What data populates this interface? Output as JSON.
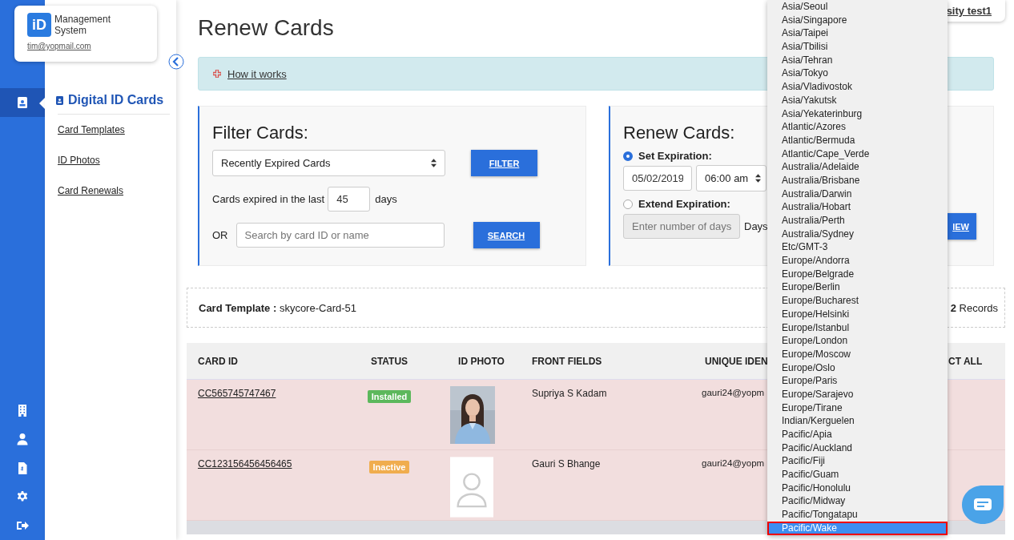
{
  "brand": {
    "logo": "iD",
    "name": "Management System",
    "email": "tim@yopmail.com"
  },
  "rail": [
    {
      "kind": "badge",
      "selected": true
    },
    {
      "kind": "building",
      "selected": false
    },
    {
      "kind": "user",
      "selected": false
    },
    {
      "kind": "invoice",
      "selected": false
    },
    {
      "kind": "settings",
      "selected": false
    },
    {
      "kind": "logout",
      "selected": false
    }
  ],
  "submenu": {
    "title": "Digital ID Cards",
    "links": [
      "Card Templates",
      "ID Photos",
      "Card Renewals"
    ]
  },
  "account": {
    "name": "sity test1"
  },
  "page_title": "Renew Cards",
  "info": {
    "link": "How it works"
  },
  "filter": {
    "title": "Filter Cards:",
    "select": "Recently Expired Cards",
    "filter_button": "FILTER",
    "days_before": "Cards expired in the last",
    "days_value": "45",
    "days_after": "days",
    "or": "OR",
    "search_placeholder": "Search by card ID or name",
    "search_button": "SEARCH"
  },
  "renew": {
    "title": "Renew Cards:",
    "options": [
      {
        "label": "Set Expiration:",
        "selected": true
      },
      {
        "label": "Extend Expiration:",
        "selected": false
      }
    ],
    "date": "05/02/2019",
    "time": "06:00 am",
    "days_placeholder": "Enter number of days",
    "days_unit": "Days",
    "button": "IEW"
  },
  "template": {
    "label": "Card Template :",
    "name": "skycore-Card-51",
    "count": "2",
    "count_label": "Records"
  },
  "table": {
    "columns": [
      "CARD ID",
      "STATUS",
      "ID PHOTO",
      "FRONT FIELDS",
      "UNIQUE IDEN",
      "CT ALL"
    ],
    "rows": [
      {
        "card_id": "CC565745747467",
        "status": {
          "label": "Installed",
          "kind": "installed"
        },
        "front": "Supriya S Kadam",
        "unique": "gauri24@yopm"
      },
      {
        "card_id": "CC123156456456465",
        "status": {
          "label": "Inactive",
          "kind": "inactive"
        },
        "photo": {
          "kind": "empty"
        },
        "front": "Gauri S Bhange",
        "unique": "gauri24@yopm"
      }
    ]
  },
  "timezones": [
    {
      "label": "Asia/Seoul",
      "selected": false
    },
    {
      "label": "Asia/Singapore",
      "selected": false
    },
    {
      "label": "Asia/Taipei",
      "selected": false
    },
    {
      "label": "Asia/Tbilisi",
      "selected": false
    },
    {
      "label": "Asia/Tehran",
      "selected": false
    },
    {
      "label": "Asia/Tokyo",
      "selected": false
    },
    {
      "label": "Asia/Vladivostok",
      "selected": false
    },
    {
      "label": "Asia/Yakutsk",
      "selected": false
    },
    {
      "label": "Asia/Yekaterinburg",
      "selected": false
    },
    {
      "label": "Atlantic/Azores",
      "selected": false
    },
    {
      "label": "Atlantic/Bermuda",
      "selected": false
    },
    {
      "label": "Atlantic/Cape_Verde",
      "selected": false
    },
    {
      "label": "Australia/Adelaide",
      "selected": false
    },
    {
      "label": "Australia/Brisbane",
      "selected": false
    },
    {
      "label": "Australia/Darwin",
      "selected": false
    },
    {
      "label": "Australia/Hobart",
      "selected": false
    },
    {
      "label": "Australia/Perth",
      "selected": false
    },
    {
      "label": "Australia/Sydney",
      "selected": false
    },
    {
      "label": "Etc/GMT-3",
      "selected": false
    },
    {
      "label": "Europe/Andorra",
      "selected": false
    },
    {
      "label": "Europe/Belgrade",
      "selected": false
    },
    {
      "label": "Europe/Berlin",
      "selected": false
    },
    {
      "label": "Europe/Bucharest",
      "selected": false
    },
    {
      "label": "Europe/Helsinki",
      "selected": false
    },
    {
      "label": "Europe/Istanbul",
      "selected": false
    },
    {
      "label": "Europe/London",
      "selected": false
    },
    {
      "label": "Europe/Moscow",
      "selected": false
    },
    {
      "label": "Europe/Oslo",
      "selected": false
    },
    {
      "label": "Europe/Paris",
      "selected": false
    },
    {
      "label": "Europe/Sarajevo",
      "selected": false
    },
    {
      "label": "Europe/Tirane",
      "selected": false
    },
    {
      "label": "Indian/Kerguelen",
      "selected": false
    },
    {
      "label": "Pacific/Apia",
      "selected": false
    },
    {
      "label": "Pacific/Auckland",
      "selected": false
    },
    {
      "label": "Pacific/Fiji",
      "selected": false
    },
    {
      "label": "Pacific/Guam",
      "selected": false
    },
    {
      "label": "Pacific/Honolulu",
      "selected": false
    },
    {
      "label": "Pacific/Midway",
      "selected": false
    },
    {
      "label": "Pacific/Tongatapu",
      "selected": false
    },
    {
      "label": "Pacific/Wake",
      "selected": true
    }
  ]
}
